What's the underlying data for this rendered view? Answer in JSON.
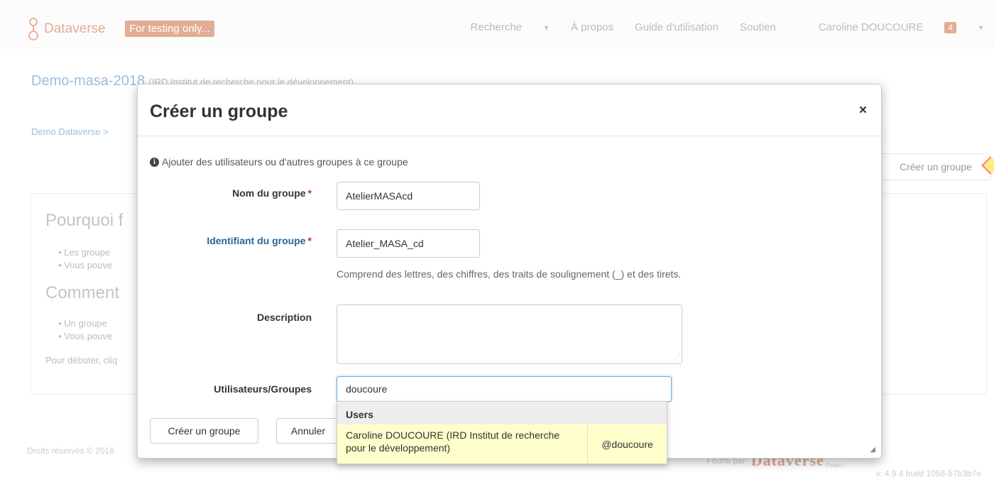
{
  "navbar": {
    "brand": "Dataverse",
    "test_badge": "For testing only...",
    "items": [
      "Recherche",
      "À propos",
      "Guide d'utilisation",
      "Soutien"
    ],
    "user": "Caroline DOUCOURE",
    "notification_count": "4"
  },
  "background": {
    "dataverse_title": "Demo-masa-2018",
    "dataverse_affiliation": "(IRD Institut de recherche pour le développement)",
    "breadcrumb": "Demo Dataverse > ",
    "create_group_button": "Créer un groupe",
    "heading_why": "Pourquoi f",
    "why_items": [
      "Les groupe",
      "Vous pouve"
    ],
    "heading_how": "Comment ",
    "how_items": [
      "Un groupe",
      "Vous pouve"
    ],
    "start_text": "Pour débuter, cliq",
    "footer": "Droits réservés © 2018",
    "powered_by": "Fourni par",
    "powered_logo": "Dataverse",
    "powered_project": "Project",
    "version": "v. 4.9.4 build 1058-57b3b7e"
  },
  "modal": {
    "title": "Créer un groupe",
    "close": "×",
    "info": "Ajouter des utilisateurs ou d'autres groupes à ce groupe",
    "group_name": {
      "label": "Nom du groupe",
      "value": "AtelierMASAcd"
    },
    "group_id": {
      "label": "Identifiant du groupe",
      "value": "Atelier_MASA_cd",
      "help": "Comprend des lettres, des chiffres, des traits de soulignement (_) et des tirets."
    },
    "description": {
      "label": "Description",
      "value": ""
    },
    "users_groups": {
      "label": "Utilisateurs/Groupes",
      "value": "doucoure"
    },
    "create_button": "Créer un groupe",
    "cancel_button": "Annuler",
    "autocomplete": {
      "header": "Users",
      "results": [
        {
          "name": "Caroline DOUCOURE (IRD Institut de recherche pour le développement)",
          "handle": "@doucoure"
        }
      ]
    }
  },
  "colors": {
    "brand": "#c55b28",
    "link": "#337ab7",
    "highlight": "#ffffcc"
  }
}
